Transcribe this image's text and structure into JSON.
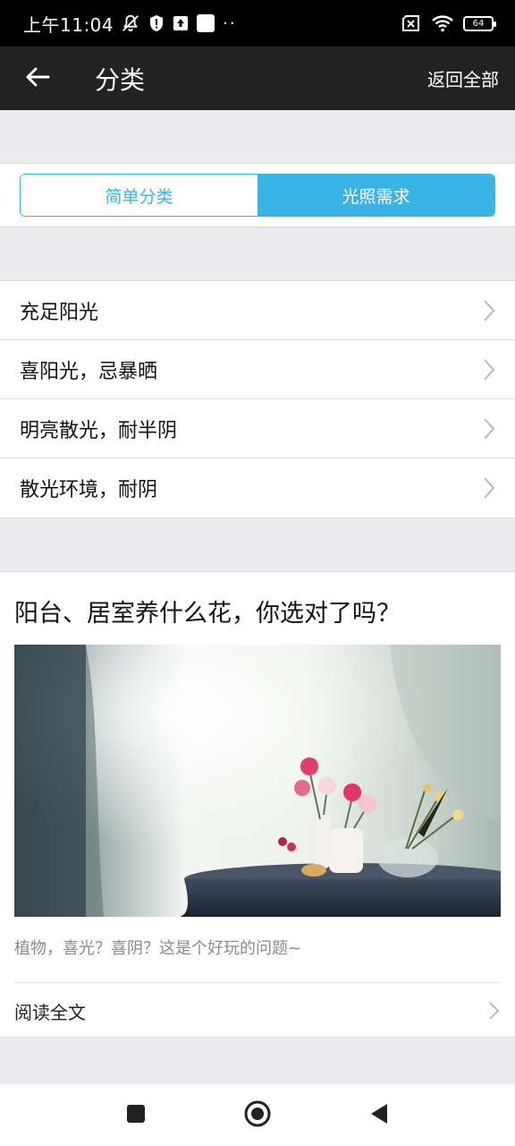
{
  "status_bar": {
    "time": "上午11:04",
    "battery": "64",
    "icons_left": [
      "bell-off-icon",
      "shield-alert-icon",
      "upload-icon",
      "square-icon",
      "more-dots-icon"
    ],
    "icons_right": [
      "sim-off-icon",
      "wifi-icon",
      "battery-icon"
    ]
  },
  "app_bar": {
    "title": "分类",
    "action": "返回全部"
  },
  "segment": {
    "tabs": [
      {
        "label": "简单分类",
        "active": false
      },
      {
        "label": "光照需求",
        "active": true
      }
    ]
  },
  "list": {
    "items": [
      {
        "label": "充足阳光"
      },
      {
        "label": "喜阳光，忌暴晒"
      },
      {
        "label": "明亮散光，耐半阴"
      },
      {
        "label": "散光环境，耐阴"
      }
    ]
  },
  "article": {
    "title": "阳台、居室养什么花，你选对了吗？",
    "description": "植物，喜光？喜阴？这是个好玩的问题~",
    "read_more": "阅读全文"
  },
  "colors": {
    "accent": "#3ab3e6",
    "app_bar": "#222222",
    "background": "#ebebef"
  }
}
